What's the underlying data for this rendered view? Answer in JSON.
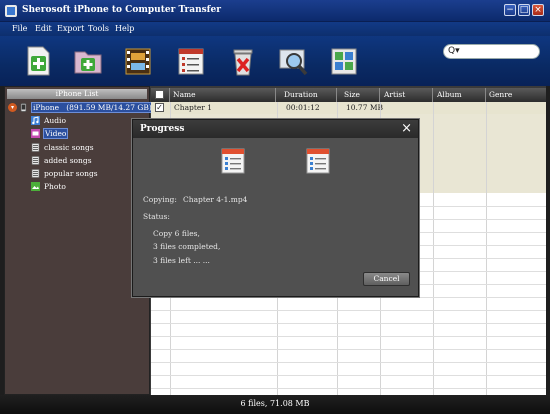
{
  "window": {
    "title": "Sherosoft iPhone to Computer Transfer",
    "minimize_glyph": "−",
    "maximize_glyph": "□",
    "close_glyph": "×"
  },
  "menu": [
    "File",
    "Edit",
    "Export",
    "Tools",
    "Help"
  ],
  "toolbar": {
    "buttons": [
      {
        "name": "add-file",
        "icon": "add-file-icon"
      },
      {
        "name": "add-folder",
        "icon": "add-folder-icon"
      },
      {
        "name": "export-video",
        "icon": "film-export-icon"
      },
      {
        "name": "export-list",
        "icon": "list-export-icon"
      },
      {
        "name": "delete",
        "icon": "trash-delete-icon"
      },
      {
        "name": "search-device",
        "icon": "magnifier-icon"
      },
      {
        "name": "settings",
        "icon": "grid-settings-icon"
      }
    ],
    "search": {
      "icon_glyph": "Q▾",
      "value": "",
      "placeholder": ""
    }
  },
  "sidebar": {
    "header": "iPhone List",
    "device": {
      "label": "iPhone",
      "capacity": "(891.59 MB/14.27 GB)",
      "expand_glyph": "▾"
    },
    "items": [
      {
        "label": "Audio",
        "icon": "music-note-icon",
        "selected": false
      },
      {
        "label": "Video",
        "icon": "video-icon",
        "selected": true
      },
      {
        "label": "classic songs",
        "icon": "playlist-icon",
        "selected": false
      },
      {
        "label": "added songs",
        "icon": "playlist-icon",
        "selected": false
      },
      {
        "label": "popular songs",
        "icon": "playlist-icon",
        "selected": false
      },
      {
        "label": "Photo",
        "icon": "photo-icon",
        "selected": false
      }
    ]
  },
  "table": {
    "columns": [
      "Name",
      "Duration",
      "Size",
      "Artist",
      "Album",
      "Genre"
    ],
    "header_checked": false,
    "rows": [
      {
        "checked": true,
        "check_glyph": "✓",
        "name": "Chapter 1",
        "duration": "00:01:12",
        "size": "10.77 MB",
        "artist": "",
        "album": "",
        "genre": ""
      }
    ]
  },
  "status": {
    "summary": "6 files, 71.08 MB"
  },
  "dialog": {
    "title": "Progress",
    "close_glyph": "×",
    "copying_label": "Copying:",
    "copying_file": "Chapter 4-1.mp4",
    "status_label": "Status:",
    "status_lines": [
      "Copy 6 files,",
      "3 files completed,",
      "3 files left ... ..."
    ],
    "cancel_label": "Cancel"
  },
  "colors": {
    "title_bar": "#1b3e8e",
    "sidebar_bg": "#4a3d3b",
    "selection": "#2b4f9e",
    "row_highlight": "#e7e4cf",
    "dialog_bg": "#505050"
  }
}
